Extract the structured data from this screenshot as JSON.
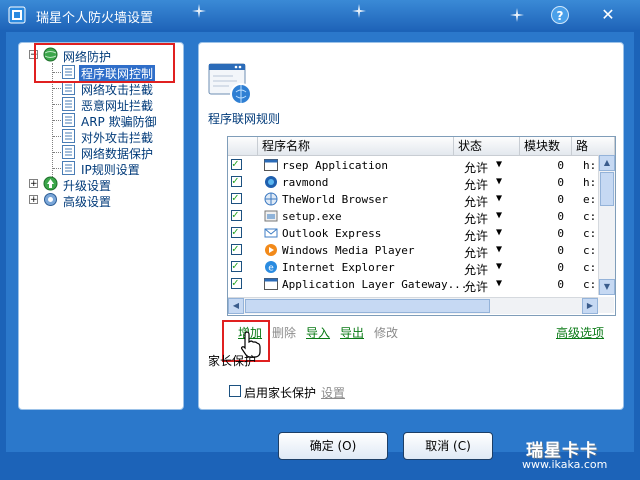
{
  "window": {
    "title": "瑞星个人防火墙设置",
    "help": "?",
    "close": "✕"
  },
  "tree": {
    "network": "网络防护",
    "children": [
      "程序联网控制",
      "网络攻击拦截",
      "恶意网址拦截",
      "ARP 欺骗防御",
      "对外攻击拦截",
      "网络数据保护",
      "IP规则设置"
    ],
    "upgrade": "升级设置",
    "advanced": "高级设置"
  },
  "section": {
    "title": "程序联网规则"
  },
  "table": {
    "headers": [
      "程序名称",
      "状态",
      "模块数",
      "路"
    ],
    "rows": [
      {
        "name": "rsep Application",
        "status": "允许",
        "modules": "0",
        "path": "h:"
      },
      {
        "name": "ravmond",
        "status": "允许",
        "modules": "0",
        "path": "h:"
      },
      {
        "name": "TheWorld Browser",
        "status": "允许",
        "modules": "0",
        "path": "e:"
      },
      {
        "name": "setup.exe",
        "status": "允许",
        "modules": "0",
        "path": "c:"
      },
      {
        "name": "Outlook Express",
        "status": "允许",
        "modules": "0",
        "path": "c:"
      },
      {
        "name": "Windows Media Player",
        "status": "允许",
        "modules": "0",
        "path": "c:"
      },
      {
        "name": "Internet Explorer",
        "status": "允许",
        "modules": "0",
        "path": "c:"
      },
      {
        "name": "Application Layer Gateway...",
        "status": "允许",
        "modules": "0",
        "path": "c:"
      }
    ]
  },
  "actions": {
    "add": "增加",
    "delete": "删除",
    "import": "导入",
    "export": "导出",
    "modify": "修改",
    "advanced": "高级选项"
  },
  "family": {
    "title": "家长保护",
    "enable": "启用家长保护",
    "settings": "设置"
  },
  "buttons": {
    "ok": "确定 (O)",
    "cancel": "取消 (C)"
  },
  "watermark": {
    "brand": "瑞星卡卡",
    "url": "www.ikaka.com"
  },
  "colors": {
    "accent": "#1c63b8",
    "highlight": "#e02020",
    "link": "#0a7a16"
  }
}
